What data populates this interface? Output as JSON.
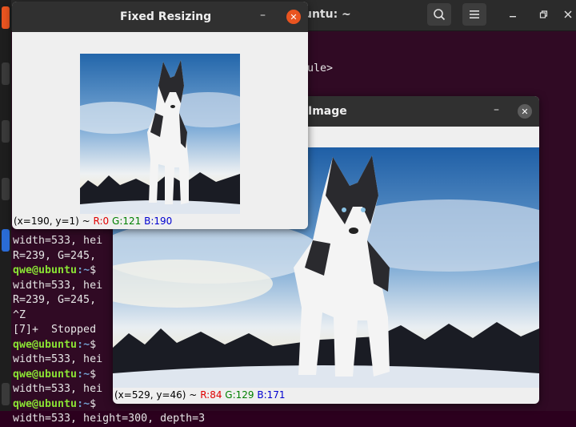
{
  "terminal": {
    "title": "ubuntu: ~",
    "fragment_include": "ule>",
    "lines": [
      {
        "kind": "text",
        "text": "width=533, hei"
      },
      {
        "kind": "text",
        "text": "R=239, G=245,"
      },
      {
        "kind": "prompt",
        "user": "qwe@ubuntu",
        "path": ":~",
        "end": "$"
      },
      {
        "kind": "text",
        "text": "width=533, hei"
      },
      {
        "kind": "text",
        "text": "R=239, G=245,"
      },
      {
        "kind": "text",
        "text": "^Z"
      },
      {
        "kind": "text",
        "text": "[7]+  Stopped"
      },
      {
        "kind": "prompt",
        "user": "qwe@ubuntu",
        "path": ":~",
        "end": "$"
      },
      {
        "kind": "text",
        "text": "width=533, hei"
      },
      {
        "kind": "prompt",
        "user": "qwe@ubuntu",
        "path": ":~",
        "end": "$"
      },
      {
        "kind": "text",
        "text": "width=533, hei"
      },
      {
        "kind": "prompt",
        "user": "qwe@ubuntu",
        "path": ":~",
        "end": "$"
      },
      {
        "kind": "text",
        "text": "width=533, height=300, depth=3"
      }
    ]
  },
  "window_small": {
    "title": "Fixed Resizing",
    "minimize": "–",
    "close": "✕",
    "status": {
      "coords": "(x=190, y=1) ~",
      "r": "R:0",
      "g": "G:121",
      "b": "B:190"
    }
  },
  "window_large": {
    "title": "Image",
    "minimize": "–",
    "close": "✕",
    "status": {
      "coords": "(x=529, y=46) ~",
      "r": "R:84",
      "g": "G:129",
      "b": "B:171"
    }
  },
  "icons": {
    "search": "search-icon",
    "menu": "hamburger-menu-icon",
    "minimize": "minimize-icon",
    "restore": "restore-icon",
    "close": "close-icon"
  },
  "colors": {
    "ubuntu_orange": "#e95420",
    "terminal_bg": "#300a24",
    "prompt_green": "#8ae234",
    "prompt_blue": "#729fcf"
  }
}
